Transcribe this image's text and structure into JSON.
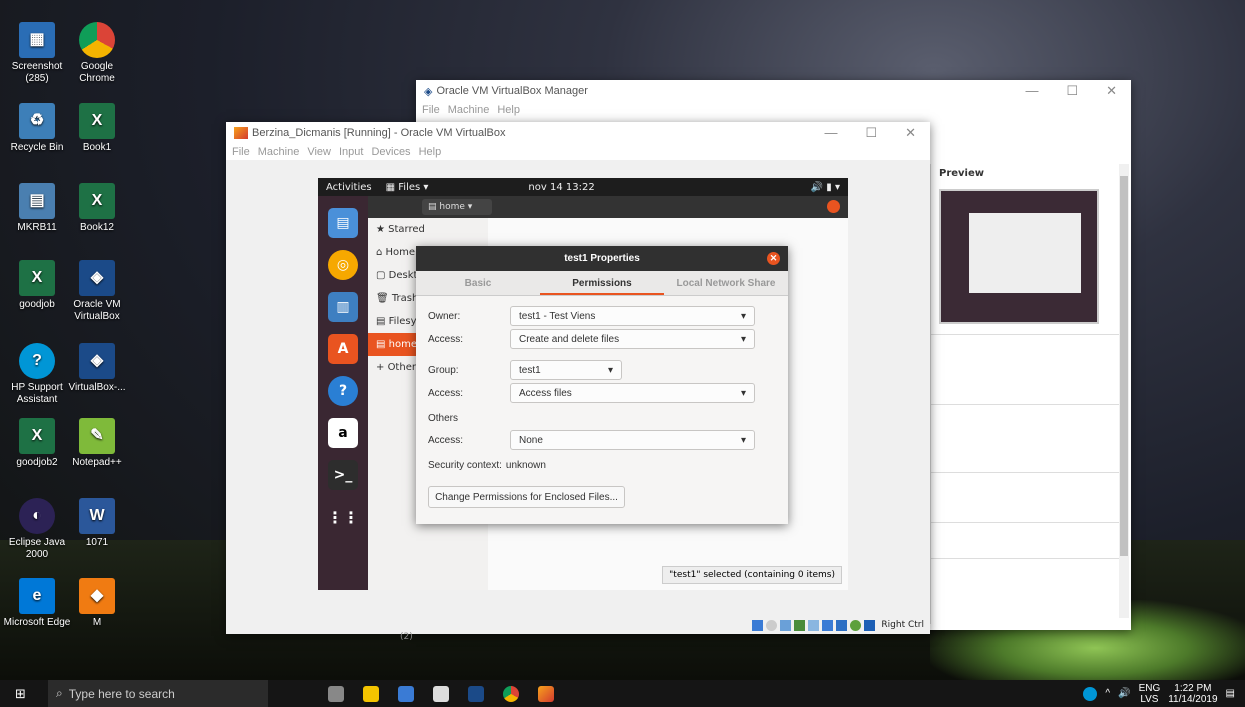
{
  "desktop": {
    "icons": [
      {
        "label": "Screenshot (285)"
      },
      {
        "label": "Google Chrome"
      },
      {
        "label": "Recycle Bin"
      },
      {
        "label": "Book1"
      },
      {
        "label": "MKRB11"
      },
      {
        "label": "Book12"
      },
      {
        "label": "goodjob"
      },
      {
        "label": "Oracle VM VirtualBox"
      },
      {
        "label": "HP Support Assistant"
      },
      {
        "label": "VirtualBox-..."
      },
      {
        "label": "goodjob2"
      },
      {
        "label": "Notepad++"
      },
      {
        "label": "Eclipse Java 2000"
      },
      {
        "label": "1071"
      },
      {
        "label": "Microsoft Edge"
      },
      {
        "label": "M"
      }
    ]
  },
  "manager": {
    "title": "Oracle VM VirtualBox Manager",
    "menu": [
      "File",
      "Machine",
      "Help"
    ],
    "preview_label": "Preview"
  },
  "vmwindow": {
    "title": "Berzina_Dicmanis [Running] - Oracle VM VirtualBox",
    "menu": [
      "File",
      "Machine",
      "View",
      "Input",
      "Devices",
      "Help"
    ],
    "host_key": "Right Ctrl",
    "below_label": "(2)"
  },
  "ubuntu": {
    "activities": "Activities",
    "app_menu": "Files",
    "clock": "nov 14  13:22",
    "location": "home",
    "sidebar": [
      "Starred",
      "Home",
      "Deskt",
      "Trash",
      "Filesy",
      "home",
      "Other"
    ],
    "status": "\"test1\" selected  (containing 0 items)"
  },
  "dialog": {
    "title": "test1 Properties",
    "tabs": [
      "Basic",
      "Permissions",
      "Local Network Share"
    ],
    "owner_label": "Owner:",
    "owner_value": "test1 - Test Viens",
    "owner_access_label": "Access:",
    "owner_access_value": "Create and delete files",
    "group_label": "Group:",
    "group_value": "test1",
    "group_access_label": "Access:",
    "group_access_value": "Access files",
    "others_label": "Others",
    "others_access_label": "Access:",
    "others_access_value": "None",
    "security_label": "Security context:",
    "security_value": "unknown",
    "change_button": "Change Permissions for Enclosed Files..."
  },
  "taskbar": {
    "search_placeholder": "Type here to search",
    "lang": "ENG",
    "lang2": "LVS",
    "time": "1:22 PM",
    "date": "11/14/2019"
  }
}
